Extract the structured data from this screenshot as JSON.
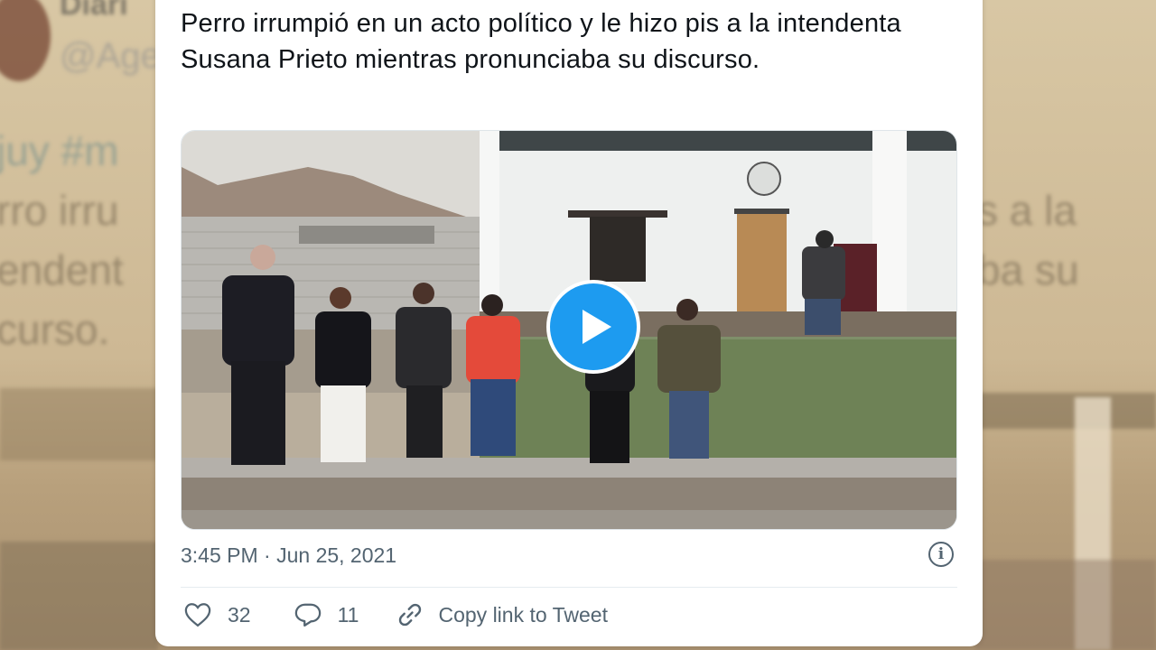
{
  "background": {
    "name_partial": "Diari",
    "handle_partial": "@Age",
    "hashtag_partial": "juy #m",
    "left_lines": [
      "rro irru",
      "endent",
      "curso."
    ],
    "right_lines": [
      "s a la",
      "ba su"
    ]
  },
  "tweet": {
    "text": "Perro irrumpió en un acto político y le hizo pis a la intendenta Susana Prieto mientras pronunciaba su discurso.",
    "timestamp": "3:45 PM · Jun 25, 2021",
    "info_glyph": "i"
  },
  "actions": {
    "likes": "32",
    "replies": "11",
    "copy_link_label": "Copy link to Tweet"
  },
  "colors": {
    "accent": "#1d9bf0",
    "text": "#0f1419",
    "muted": "#536471"
  },
  "icons": [
    "heart-icon",
    "reply-icon",
    "link-icon",
    "info-icon",
    "play-icon"
  ]
}
